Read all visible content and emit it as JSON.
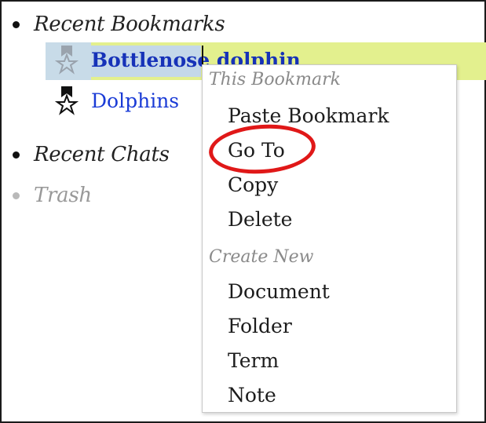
{
  "tree": {
    "recent_bookmarks": "Recent Bookmarks",
    "recent_chats": "Recent Chats",
    "trash": "Trash"
  },
  "bookmarks": [
    {
      "label": "Bottlenose dolphin",
      "selected": true,
      "icon": "bookmark-star-icon"
    },
    {
      "label": "Dolphins",
      "selected": false,
      "icon": "bookmark-star-icon"
    }
  ],
  "menu": {
    "this_bookmark_header": "This Bookmark",
    "this_bookmark_items": [
      "Paste Bookmark",
      "Go To",
      "Copy",
      "Delete"
    ],
    "create_new_header": "Create New",
    "create_new_items": [
      "Document",
      "Folder",
      "Term",
      "Note"
    ]
  },
  "colors": {
    "selection_row": "#e3f08e",
    "selection_text": "#c4d8e9",
    "link": "#1a3bd6",
    "annotation_ring": "#e01818"
  }
}
